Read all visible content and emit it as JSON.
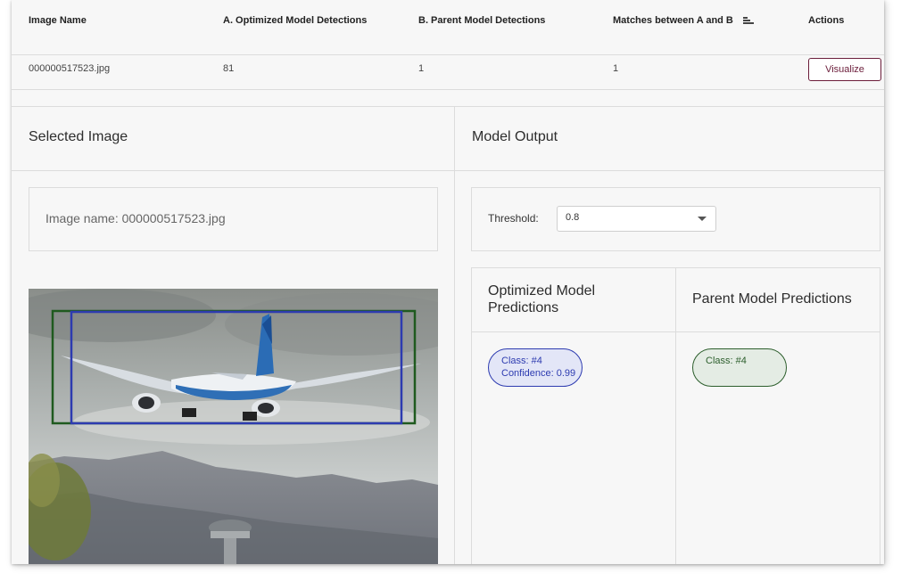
{
  "table": {
    "columns": [
      "Image Name",
      "A. Optimized Model Detections",
      "B. Parent Model Detections",
      "Matches between A and B",
      "Actions"
    ],
    "row": {
      "image_name": "000000517523.jpg",
      "optimized_detections": "81",
      "parent_detections": "1",
      "matches": "1",
      "action_label": "Visualize"
    }
  },
  "selected_image": {
    "title": "Selected Image",
    "name_text": "Image name: 000000517523.jpg"
  },
  "model_output": {
    "title": "Model Output",
    "threshold_label": "Threshold:",
    "threshold_value": "0.8",
    "optimized_title": "Optimized Model Predictions",
    "parent_title": "Parent Model Predictions",
    "optimized_chip": {
      "class": "Class: #4",
      "confidence": "Confidence: 0.99"
    },
    "parent_chip": {
      "class": "Class: #4"
    }
  },
  "colors": {
    "accent": "#6b1d3a",
    "optimized_box": "#2d3bb0",
    "parent_box": "#1f5a1f"
  }
}
